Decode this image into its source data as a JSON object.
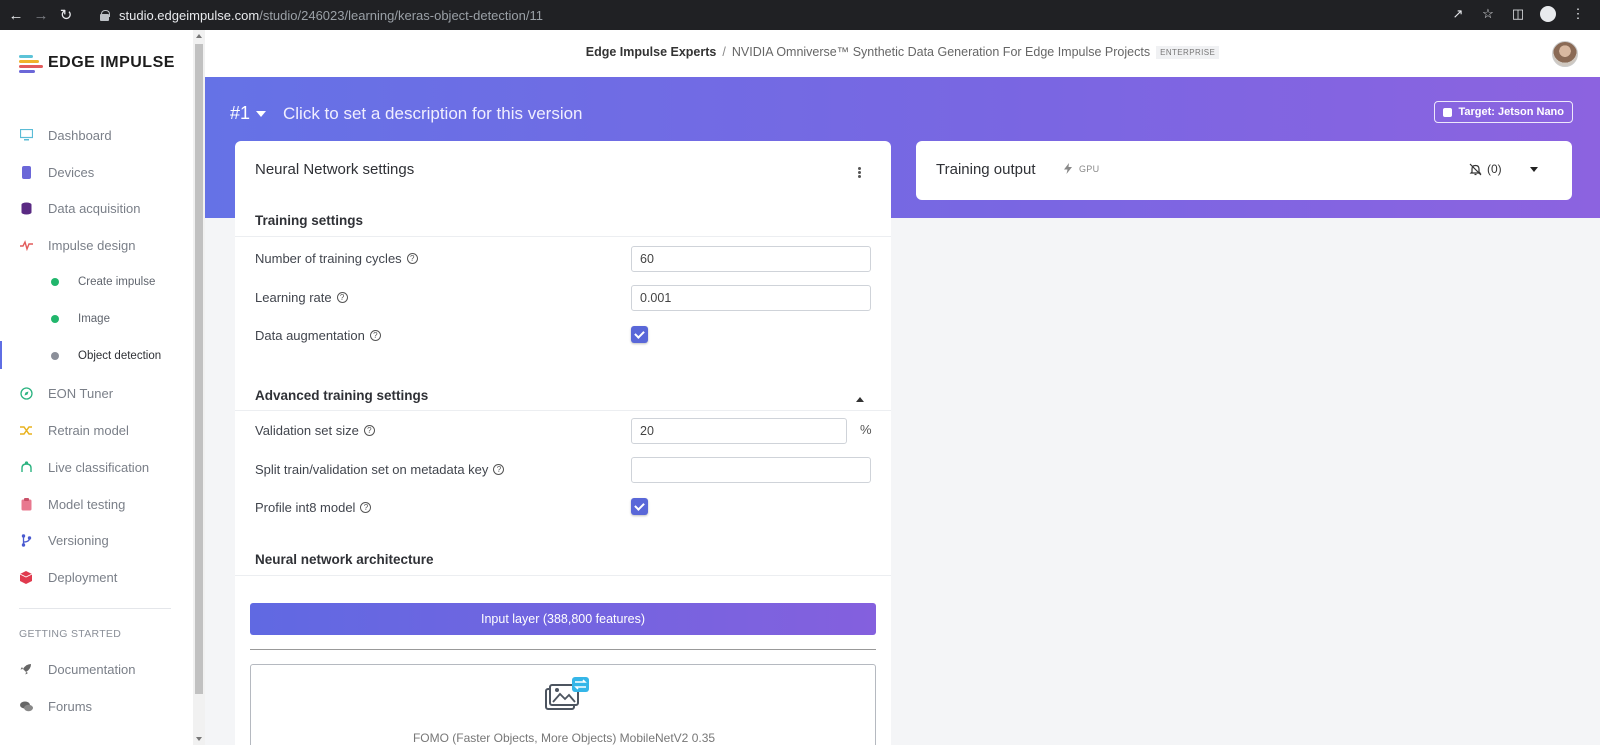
{
  "browser": {
    "url_host": "studio.edgeimpulse.com",
    "url_path": "/studio/246023/learning/keras-object-detection/11"
  },
  "sidebar": {
    "logo_text": "EDGE IMPULSE",
    "items": [
      {
        "label": "Dashboard",
        "icon": "monitor-icon",
        "color": "#5bbcd6"
      },
      {
        "label": "Devices",
        "icon": "chip-icon",
        "color": "#6b67d8"
      },
      {
        "label": "Data acquisition",
        "icon": "database-icon",
        "color": "#5a2a83"
      },
      {
        "label": "Impulse design",
        "icon": "pulse-icon",
        "color": "#e25b5b"
      }
    ],
    "sub_items": [
      {
        "label": "Create impulse",
        "status_color": "#21b66c"
      },
      {
        "label": "Image",
        "status_color": "#21b66c"
      },
      {
        "label": "Object detection",
        "status_color": "#8b8f99"
      }
    ],
    "items_after": [
      {
        "label": "EON Tuner",
        "icon": "compass-icon",
        "color": "#2bb380"
      },
      {
        "label": "Retrain model",
        "icon": "shuffle-icon",
        "color": "#e8b21f"
      },
      {
        "label": "Live classification",
        "icon": "branch-icon",
        "color": "#2bb380"
      },
      {
        "label": "Model testing",
        "icon": "clipboard-icon",
        "color": "#e8788f"
      },
      {
        "label": "Versioning",
        "icon": "git-branch-icon",
        "color": "#4a5bd0"
      },
      {
        "label": "Deployment",
        "icon": "cube-icon",
        "color": "#e03a4e"
      }
    ],
    "section_heading": "GETTING STARTED",
    "getting_started": [
      {
        "label": "Documentation",
        "icon": "rocket-icon"
      },
      {
        "label": "Forums",
        "icon": "chat-icon"
      }
    ]
  },
  "header": {
    "breadcrumb_org": "Edge Impulse Experts",
    "breadcrumb_sep": "/",
    "breadcrumb_project": "NVIDIA Omniverse™ Synthetic Data Generation For Edge Impulse Projects",
    "badge": "ENTERPRISE"
  },
  "version": {
    "number": "#1",
    "description_placeholder": "Click to set a description for this version",
    "target_label": "Target: Jetson Nano"
  },
  "nn_settings": {
    "title": "Neural Network settings",
    "training_heading": "Training settings",
    "training_cycles_label": "Number of training cycles",
    "training_cycles_value": "60",
    "learning_rate_label": "Learning rate",
    "learning_rate_value": "0.001",
    "data_augmentation_label": "Data augmentation",
    "data_augmentation_checked": true,
    "advanced_heading": "Advanced training settings",
    "validation_label": "Validation set size",
    "validation_value": "20",
    "validation_unit": "%",
    "split_label": "Split train/validation set on metadata key",
    "split_value": "",
    "profile_int8_label": "Profile int8 model",
    "profile_int8_checked": true,
    "architecture_heading": "Neural network architecture",
    "input_layer_label": "Input layer (388,800 features)",
    "model_label": "FOMO (Faster Objects, More Objects) MobileNetV2 0.35"
  },
  "training_output": {
    "title": "Training output",
    "gpu_label": "GPU",
    "notifications_label": "(0)"
  }
}
